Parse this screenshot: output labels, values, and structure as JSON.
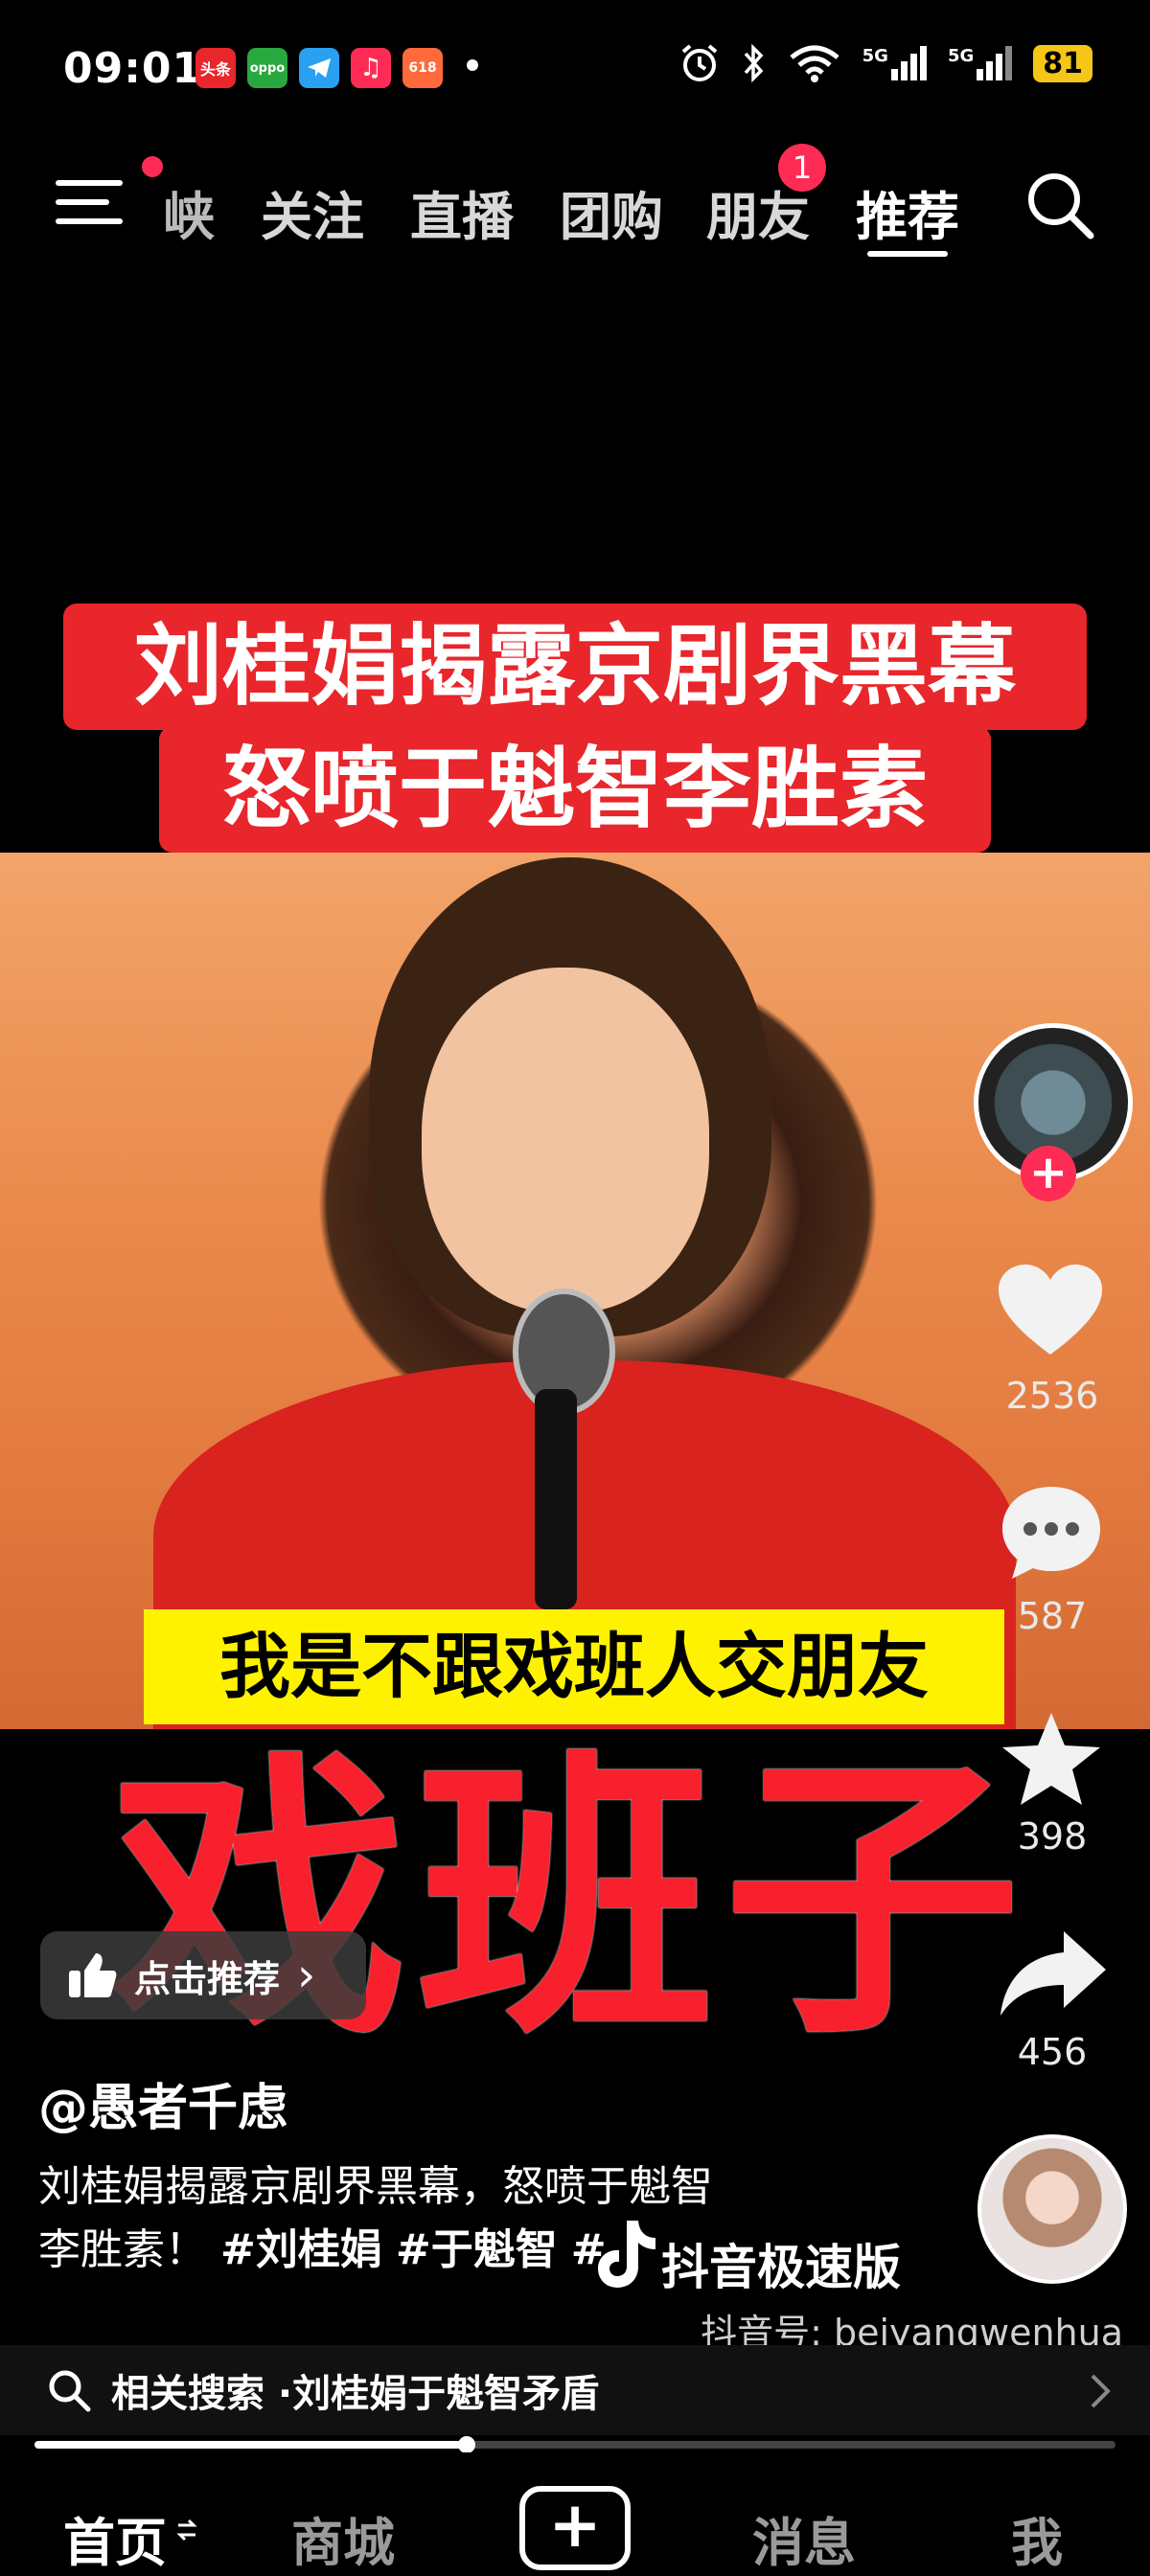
{
  "status_bar": {
    "time": "09:01",
    "battery": "81",
    "apps": [
      "头条",
      "oppo",
      "",
      "♫",
      "618"
    ],
    "signal1": "5G",
    "signal2": "5G"
  },
  "nav": {
    "partial": "峡",
    "items": [
      "关注",
      "直播",
      "团购",
      "朋友",
      "推荐"
    ],
    "friends_badge": "1",
    "active": "推荐"
  },
  "video": {
    "title_line1": "刘桂娟揭露京剧界黑幕",
    "title_line2": "怒喷于魁智李胜素",
    "subtitle": "我是不跟戏班人交朋友",
    "big_text": "戏班子"
  },
  "sidebar": {
    "likes": "2536",
    "comments": "587",
    "favorites": "398",
    "shares": "456"
  },
  "recommend_pill": {
    "label": "点击推荐",
    "chevron": "›"
  },
  "post": {
    "author": "@愚者千虑",
    "desc_line1": "刘桂娟揭露京剧界黑幕，怒喷于魁智",
    "desc_line2_text": "李胜素！",
    "tag1": "#刘桂娟",
    "tag2": "#于魁智",
    "tag3": "#",
    "watermark": "抖音极速版",
    "douyin_id": "抖音号: beiyangwenhua"
  },
  "related_search": {
    "prefix": "相关搜索 · ",
    "query": "刘桂娟于魁智矛盾"
  },
  "playback": {
    "progress": 0.4
  },
  "bottom_nav": {
    "home": "首页",
    "mall": "商城",
    "plus": "+",
    "messages": "消息",
    "me": "我"
  },
  "colors": {
    "accent": "#fe2c55",
    "title_bg": "#e8262b",
    "subtitle_bg": "#fff200",
    "big_text": "#f8202c"
  }
}
